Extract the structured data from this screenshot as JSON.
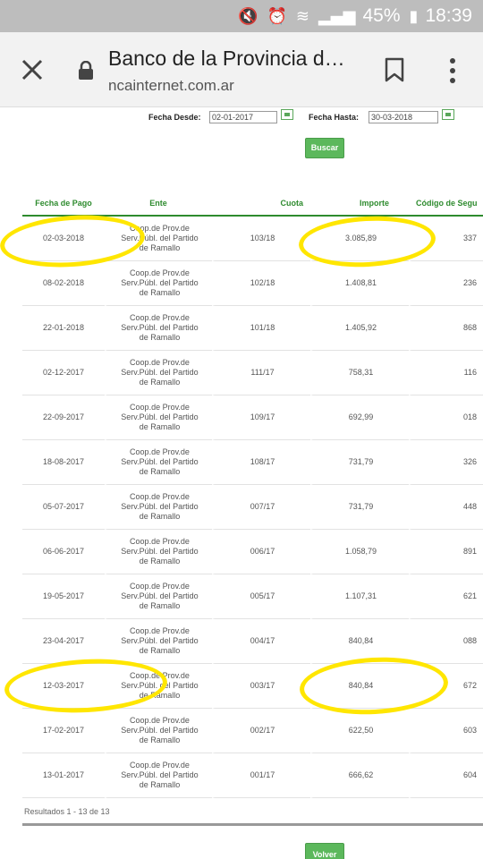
{
  "status_bar": {
    "battery": "45%",
    "time": "18:39",
    "icons": [
      "mute-icon",
      "alarm-icon",
      "wifi-icon",
      "signal-icon",
      "battery-icon"
    ]
  },
  "browser": {
    "page_title": "Banco de la Provincia d…",
    "url": "ncainternet.com.ar"
  },
  "filters": {
    "desde_label": "Fecha Desde:",
    "desde_value": "02-01-2017",
    "hasta_label": "Fecha Hasta:",
    "hasta_value": "30-03-2018",
    "buscar_label": "Buscar"
  },
  "table": {
    "headers": [
      "Fecha de Pago",
      "Ente",
      "Cuota",
      "Importe",
      "Código de Segu"
    ],
    "rows": [
      {
        "fecha": "02-03-2018",
        "ente": [
          "Coop.de Prov.de",
          "Serv.Públ. del Partido",
          "de Ramallo"
        ],
        "cuota": "103/18",
        "importe": "3.085,89",
        "codigo": "337"
      },
      {
        "fecha": "08-02-2018",
        "ente": [
          "Coop.de Prov.de",
          "Serv.Públ. del Partido",
          "de Ramallo"
        ],
        "cuota": "102/18",
        "importe": "1.408,81",
        "codigo": "236"
      },
      {
        "fecha": "22-01-2018",
        "ente": [
          "Coop.de Prov.de",
          "Serv.Públ. del Partido",
          "de Ramallo"
        ],
        "cuota": "101/18",
        "importe": "1.405,92",
        "codigo": "868"
      },
      {
        "fecha": "02-12-2017",
        "ente": [
          "Coop.de Prov.de",
          "Serv.Públ. del Partido",
          "de Ramallo"
        ],
        "cuota": "111/17",
        "importe": "758,31",
        "codigo": "116"
      },
      {
        "fecha": "22-09-2017",
        "ente": [
          "Coop.de Prov.de",
          "Serv.Públ. del Partido",
          "de Ramallo"
        ],
        "cuota": "109/17",
        "importe": "692,99",
        "codigo": "018"
      },
      {
        "fecha": "18-08-2017",
        "ente": [
          "Coop.de Prov.de",
          "Serv.Públ. del Partido",
          "de Ramallo"
        ],
        "cuota": "108/17",
        "importe": "731,79",
        "codigo": "326"
      },
      {
        "fecha": "05-07-2017",
        "ente": [
          "Coop.de Prov.de",
          "Serv.Públ. del Partido",
          "de Ramallo"
        ],
        "cuota": "007/17",
        "importe": "731,79",
        "codigo": "448"
      },
      {
        "fecha": "06-06-2017",
        "ente": [
          "Coop.de Prov.de",
          "Serv.Públ. del Partido",
          "de Ramallo"
        ],
        "cuota": "006/17",
        "importe": "1.058,79",
        "codigo": "891"
      },
      {
        "fecha": "19-05-2017",
        "ente": [
          "Coop.de Prov.de",
          "Serv.Públ. del Partido",
          "de Ramallo"
        ],
        "cuota": "005/17",
        "importe": "1.107,31",
        "codigo": "621"
      },
      {
        "fecha": "23-04-2017",
        "ente": [
          "Coop.de Prov.de",
          "Serv.Públ. del Partido",
          "de Ramallo"
        ],
        "cuota": "004/17",
        "importe": "840,84",
        "codigo": "088"
      },
      {
        "fecha": "12-03-2017",
        "ente": [
          "Coop.de Prov.de",
          "Serv.Públ. del Partido",
          "de Ramallo"
        ],
        "cuota": "003/17",
        "importe": "840,84",
        "codigo": "672"
      },
      {
        "fecha": "17-02-2017",
        "ente": [
          "Coop.de Prov.de",
          "Serv.Públ. del Partido",
          "de Ramallo"
        ],
        "cuota": "002/17",
        "importe": "622,50",
        "codigo": "603"
      },
      {
        "fecha": "13-01-2017",
        "ente": [
          "Coop.de Prov.de",
          "Serv.Públ. del Partido",
          "de Ramallo"
        ],
        "cuota": "001/17",
        "importe": "666,62",
        "codigo": "604"
      }
    ]
  },
  "results_text": "Resultados 1 - 13 de 13",
  "volver_label": "Volver",
  "highlight_color": "#ffe600",
  "accent_color": "#5cb85c"
}
